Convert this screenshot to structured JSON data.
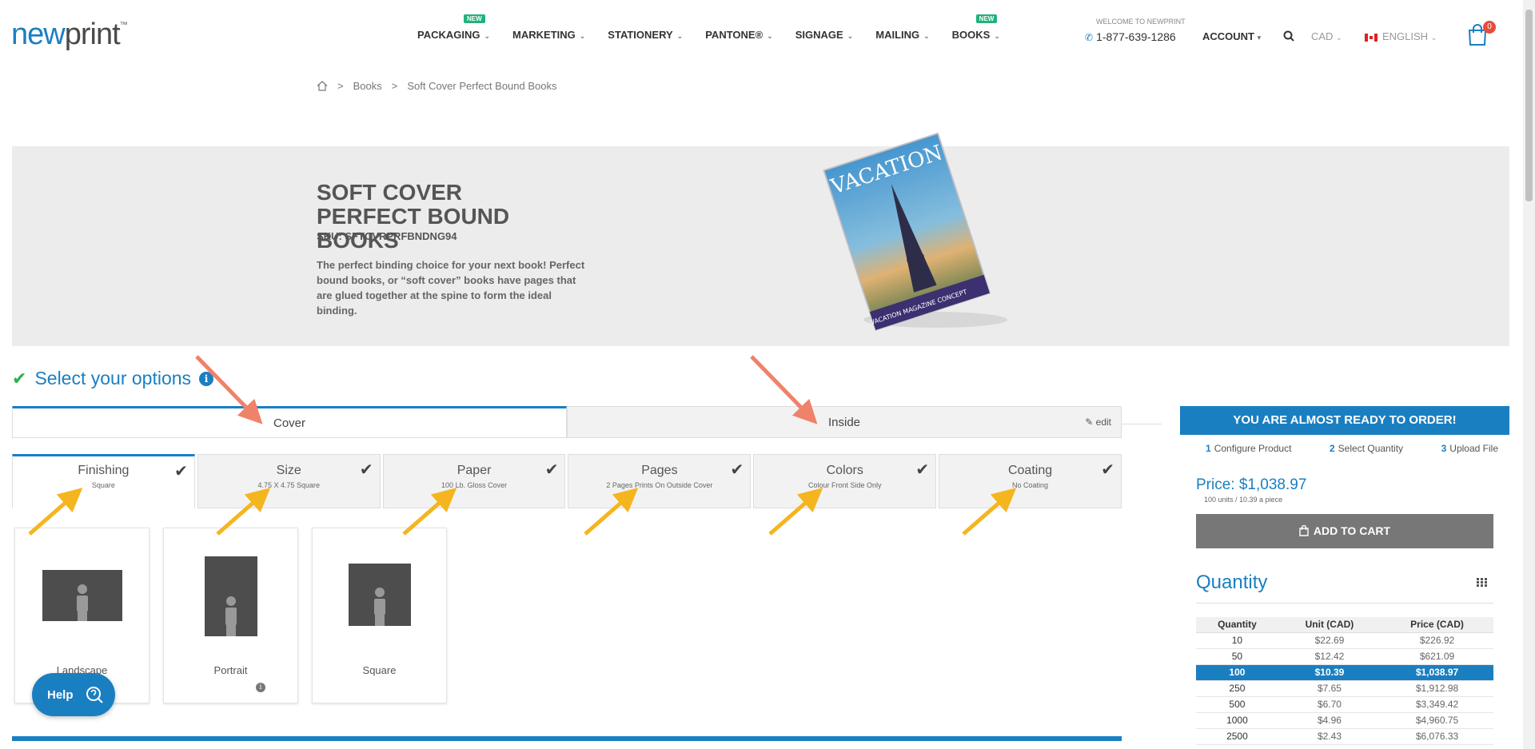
{
  "header": {
    "logo_new": "new",
    "logo_print": "print",
    "logo_tm": "™",
    "nav": [
      {
        "label": "PACKAGING",
        "badge": "NEW"
      },
      {
        "label": "MARKETING",
        "badge": ""
      },
      {
        "label": "STATIONERY",
        "badge": ""
      },
      {
        "label": "PANTONE®",
        "badge": ""
      },
      {
        "label": "SIGNAGE",
        "badge": ""
      },
      {
        "label": "MAILING",
        "badge": ""
      },
      {
        "label": "BOOKS",
        "badge": "NEW"
      }
    ],
    "welcome": "WELCOME TO NEWPRINT",
    "phone": "1-877-639-1286",
    "account": "ACCOUNT",
    "currency": "CAD",
    "language": "ENGLISH",
    "cart_count": "0"
  },
  "breadcrumb": {
    "items": [
      "Books",
      "Soft Cover Perfect Bound Books"
    ]
  },
  "hero": {
    "title": "SOFT COVER PERFECT BOUND BOOKS",
    "sku": "SKU: SFTCVRPRFBNDNG94",
    "description": "The perfect binding choice for your next book! Perfect bound books, or “soft cover” books have pages that are glued together at the spine to form the ideal binding.",
    "book_title": "VACATION",
    "book_footer": "VACATION MAGAZINE CONCEPT"
  },
  "options": {
    "heading": "Select your options",
    "info": "i",
    "tabs": [
      {
        "label": "Cover"
      },
      {
        "label": "Inside"
      }
    ],
    "edit_label": "edit",
    "subtabs": [
      {
        "name": "Finishing",
        "value": "Square"
      },
      {
        "name": "Size",
        "value": "4.75 X 4.75 Square"
      },
      {
        "name": "Paper",
        "value": "100 Lb. Gloss Cover"
      },
      {
        "name": "Pages",
        "value": "2 Pages Prints On Outside Cover"
      },
      {
        "name": "Colors",
        "value": "Colour Front Side Only"
      },
      {
        "name": "Coating",
        "value": "No Coating"
      }
    ],
    "cards": [
      {
        "label": "Landscape"
      },
      {
        "label": "Portrait"
      },
      {
        "label": "Square"
      }
    ]
  },
  "help": {
    "label": "Help"
  },
  "sidebar": {
    "heading": "YOU ARE ALMOST READY TO ORDER!",
    "steps": [
      {
        "num": "1",
        "label": "Configure Product"
      },
      {
        "num": "2",
        "label": "Select Quantity"
      },
      {
        "num": "3",
        "label": "Upload File"
      }
    ],
    "price_label": "Price:",
    "price_value": "$1,038.97",
    "price_sub": "100 units / 10.39 a piece",
    "add_to_cart": "ADD TO CART",
    "quantity_title": "Quantity",
    "table_headers": [
      "Quantity",
      "Unit (CAD)",
      "Price (CAD)"
    ],
    "table_rows": [
      [
        "10",
        "$22.69",
        "$226.92"
      ],
      [
        "50",
        "$12.42",
        "$621.09"
      ],
      [
        "100",
        "$10.39",
        "$1,038.97"
      ],
      [
        "250",
        "$7.65",
        "$1,912.98"
      ],
      [
        "500",
        "$6.70",
        "$3,349.42"
      ],
      [
        "1000",
        "$4.96",
        "$4,960.75"
      ],
      [
        "2500",
        "$2.43",
        "$6,076.33"
      ]
    ],
    "selected_row": 2
  },
  "colors": {
    "accent": "#1a7fc1",
    "badge_green": "#21b27b",
    "arrow_orange": "#f0826a",
    "arrow_yellow": "#f5b51f"
  }
}
